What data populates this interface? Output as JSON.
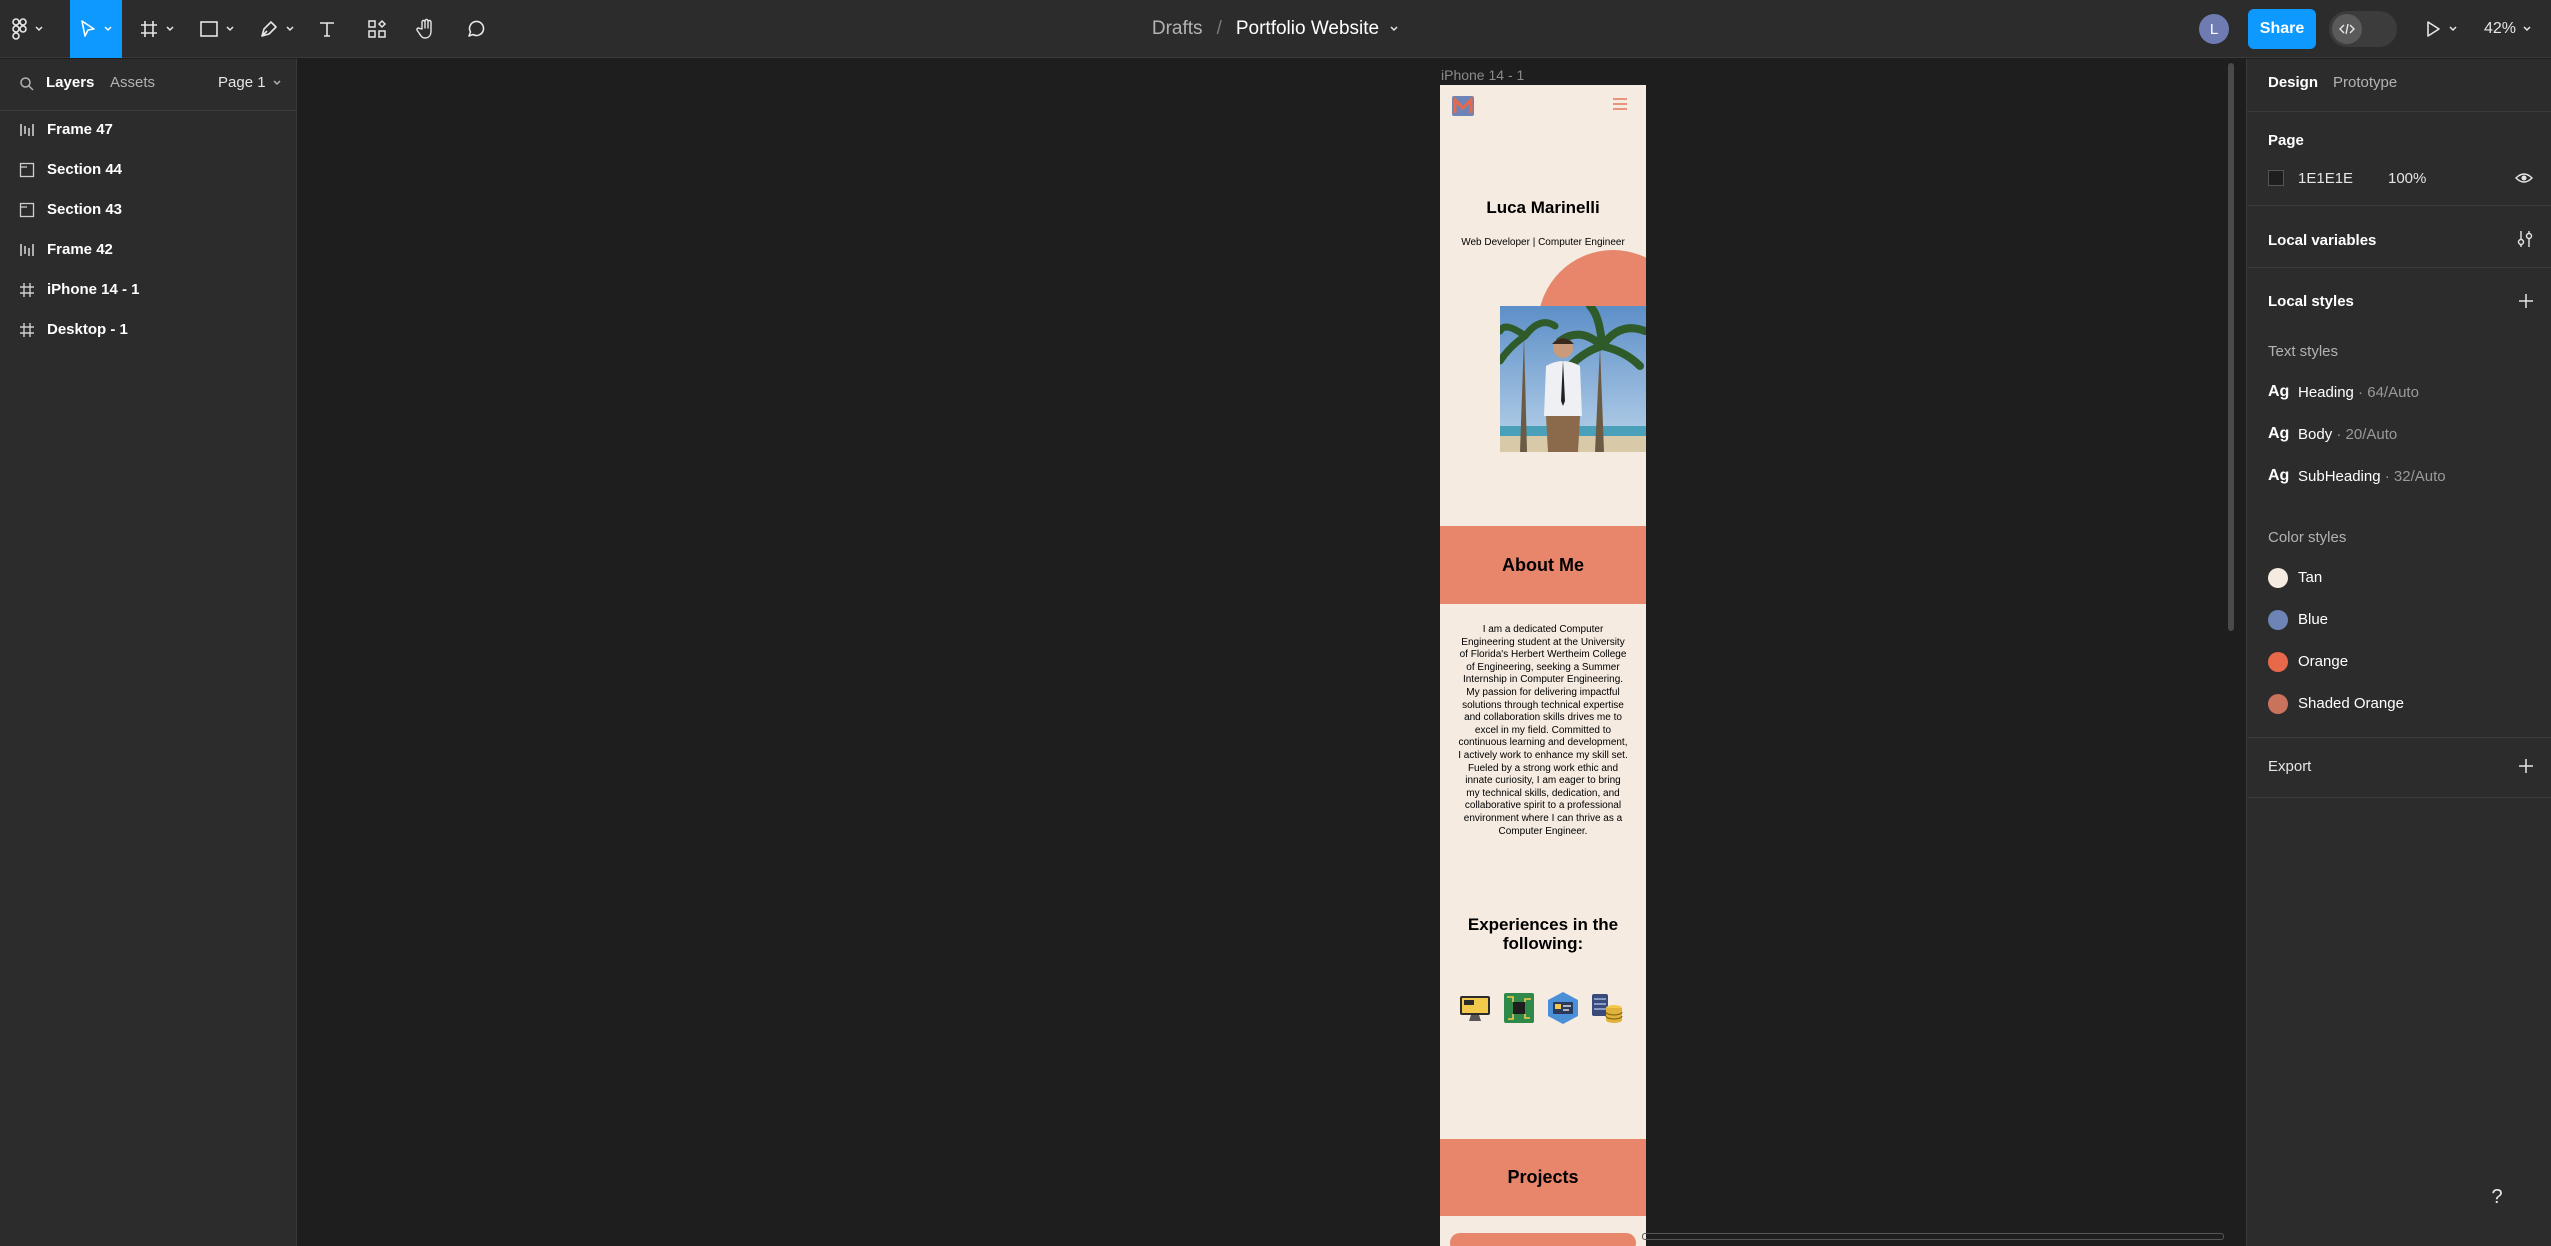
{
  "toolbar": {
    "tools": [
      "figma-menu",
      "move-tool",
      "frame-tool",
      "shape-tool",
      "pen-tool",
      "text-tool",
      "resources-tool",
      "hand-tool",
      "comment-tool"
    ],
    "breadcrumb_parent": "Drafts",
    "breadcrumb_sep": "/",
    "file_name": "Portfolio Website",
    "avatar_initial": "L",
    "share_label": "Share",
    "zoom_label": "42%",
    "accent_color": "#0d99ff"
  },
  "left_panel": {
    "tab_layers": "Layers",
    "tab_assets": "Assets",
    "page_label": "Page 1",
    "layers": [
      {
        "name": "Frame 47",
        "icon": "auto-layout-icon"
      },
      {
        "name": "Section 44",
        "icon": "section-icon"
      },
      {
        "name": "Section 43",
        "icon": "section-icon"
      },
      {
        "name": "Frame 42",
        "icon": "auto-layout-icon"
      },
      {
        "name": "iPhone 14 - 1",
        "icon": "frame-icon"
      },
      {
        "name": "Desktop - 1",
        "icon": "frame-icon"
      }
    ]
  },
  "right_panel": {
    "tab_design": "Design",
    "tab_prototype": "Prototype",
    "page_heading": "Page",
    "page_color_hex": "1E1E1E",
    "page_opacity": "100%",
    "local_variables": "Local variables",
    "local_styles": "Local styles",
    "text_styles_label": "Text styles",
    "text_styles": [
      {
        "ag": "Ag",
        "name": "Heading",
        "meta": " · 64/Auto"
      },
      {
        "ag": "Ag",
        "name": "Body",
        "meta": " · 20/Auto"
      },
      {
        "ag": "Ag",
        "name": "SubHeading",
        "meta": " · 32/Auto"
      }
    ],
    "color_styles_label": "Color styles",
    "color_styles": [
      {
        "name": "Tan",
        "color": "#f5ebe1"
      },
      {
        "name": "Blue",
        "color": "#6f84b6"
      },
      {
        "name": "Orange",
        "color": "#e8694a"
      },
      {
        "name": "Shaded Orange",
        "color": "#c9735d"
      }
    ],
    "export_label": "Export"
  },
  "canvas": {
    "frame_label": "iPhone 14 - 1",
    "help_label": "?",
    "phone": {
      "name": "Luca Marinelli",
      "role": "Web Developer | Computer Engineer",
      "about_title": "About Me",
      "about_text": "I am a dedicated Computer Engineering student at the University of Florida's Herbert Wertheim College of Engineering, seeking a Summer Internship in Computer Engineering. My passion for delivering impactful solutions through technical expertise and collaboration skills drives me to excel in my field. Committed to continuous learning and development, I actively work to enhance my skill set. Fueled by a strong work ethic and innate curiosity, I am eager to bring my technical skills, dedication, and collaborative spirit to a professional environment where I can thrive as a Computer Engineer.",
      "experiences_title": "Experiences in the following:",
      "experience_icons": [
        "web-development-icon",
        "circuit-board-icon",
        "id-card-icon",
        "database-icon"
      ],
      "projects_title": "Projects",
      "colors": {
        "tan": "#f5ebe1",
        "orange": "#e8866b"
      }
    }
  }
}
